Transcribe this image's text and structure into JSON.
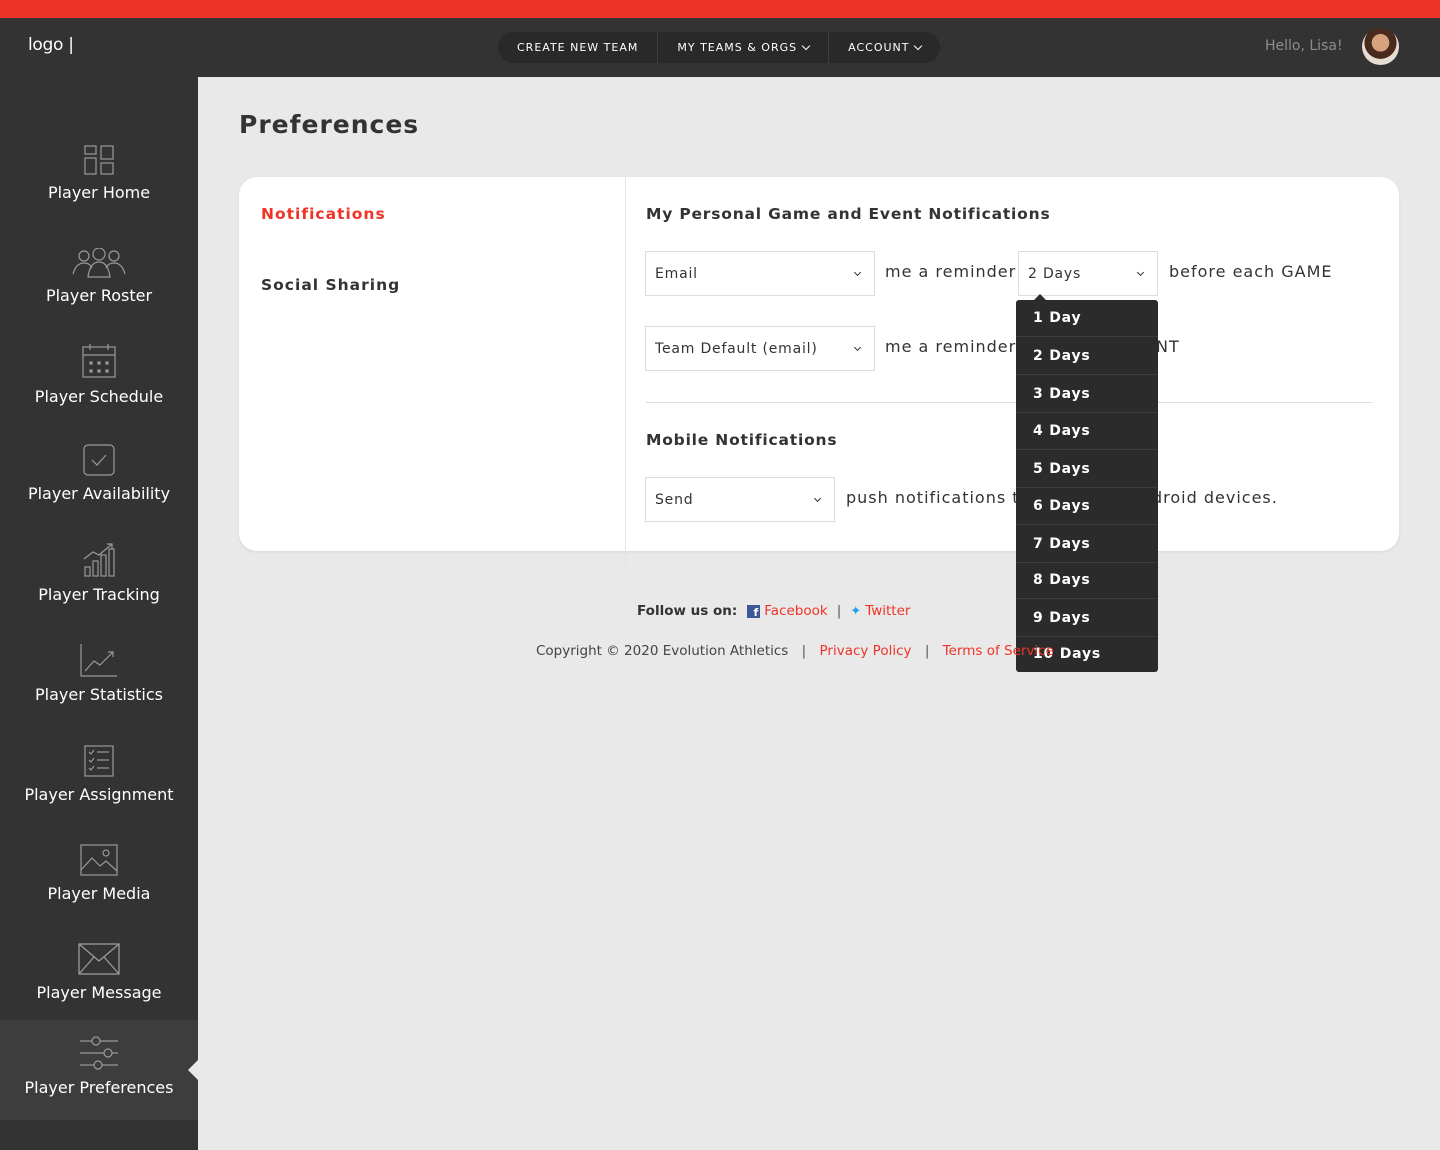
{
  "header": {
    "logo": "logo |",
    "nav": [
      {
        "label": "CREATE NEW TEAM",
        "caret": false
      },
      {
        "label": "MY TEAMS & ORGS",
        "caret": true
      },
      {
        "label": "ACCOUNT",
        "caret": true
      }
    ],
    "greeting": "Hello, Lisa!",
    "accent_color": "#ee3427"
  },
  "sidebar": {
    "items": [
      {
        "label": "Player Home",
        "icon": "dashboard-icon"
      },
      {
        "label": "Player Roster",
        "icon": "group-icon"
      },
      {
        "label": "Player Schedule",
        "icon": "calendar-icon"
      },
      {
        "label": "Player Availability",
        "icon": "checkbox-icon"
      },
      {
        "label": "Player Tracking",
        "icon": "bar-chart-icon"
      },
      {
        "label": "Player Statistics",
        "icon": "trend-line-icon"
      },
      {
        "label": "Player Assignment",
        "icon": "checklist-icon"
      },
      {
        "label": "Player Media",
        "icon": "image-icon"
      },
      {
        "label": "Player Message",
        "icon": "envelope-icon"
      },
      {
        "label": "Player Preferences",
        "icon": "sliders-icon",
        "active": true
      }
    ]
  },
  "main": {
    "title": "Preferences",
    "left_tabs": [
      {
        "label": "Notifications",
        "active": true
      },
      {
        "label": "Social Sharing",
        "active": false
      }
    ],
    "personal": {
      "title": "My Personal Game and Event Notifications",
      "row1": {
        "method": "Email",
        "text1": "me a reminder",
        "days": "2 Days",
        "text2": "before each GAME"
      },
      "row2": {
        "method": "Team Default (email)",
        "text1": "me a reminder",
        "text2_fragment": "NT"
      }
    },
    "mobile": {
      "title": "Mobile Notifications",
      "method": "Send",
      "text_left": "push notifications to",
      "text_right": "droid devices."
    },
    "dropdown": {
      "options": [
        "1 Day",
        "2 Days",
        "3 Days",
        "4 Days",
        "5 Days",
        "6 Days",
        "7 Days",
        "8 Days",
        "9 Days",
        "10 Days"
      ]
    }
  },
  "footer": {
    "follow_label": "Follow us on:",
    "facebook": "Facebook",
    "twitter": "Twitter",
    "sep": "|",
    "copyright": "Copyright © 2020 Evolution Athletics",
    "privacy": "Privacy Policy",
    "terms": "Terms of Service"
  }
}
